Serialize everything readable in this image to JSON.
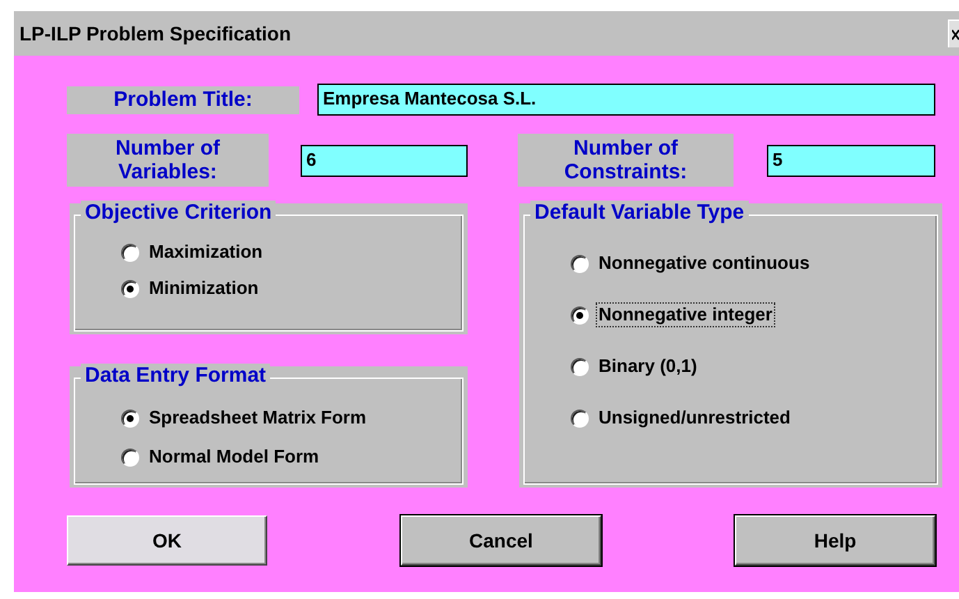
{
  "window": {
    "title": "LP-ILP Problem Specification"
  },
  "problem_title": {
    "label": "Problem Title:",
    "value": "Empresa Mantecosa S.L."
  },
  "variables": {
    "label": [
      "Number of",
      "Variables:"
    ],
    "value": "6"
  },
  "constraints": {
    "label": [
      "Number of",
      "Constraints:"
    ],
    "value": "5"
  },
  "objective_criterion": {
    "title": "Objective Criterion",
    "options": [
      {
        "label": "Maximization",
        "selected": false,
        "focused": false
      },
      {
        "label": "Minimization",
        "selected": true,
        "focused": false
      }
    ]
  },
  "data_entry_format": {
    "title": "Data Entry Format",
    "options": [
      {
        "label": "Spreadsheet Matrix Form",
        "selected": true,
        "focused": false
      },
      {
        "label": "Normal Model Form",
        "selected": false,
        "focused": false
      }
    ]
  },
  "default_variable_type": {
    "title": "Default Variable Type",
    "options": [
      {
        "label": "Nonnegative continuous",
        "selected": false,
        "focused": false
      },
      {
        "label": "Nonnegative integer",
        "selected": true,
        "focused": true
      },
      {
        "label": "Binary (0,1)",
        "selected": false,
        "focused": false
      },
      {
        "label": "Unsigned/unrestricted",
        "selected": false,
        "focused": false
      }
    ]
  },
  "buttons": [
    {
      "label": "OK",
      "focused": true
    },
    {
      "label": "Cancel",
      "focused": false
    },
    {
      "label": "Help",
      "focused": false
    }
  ]
}
